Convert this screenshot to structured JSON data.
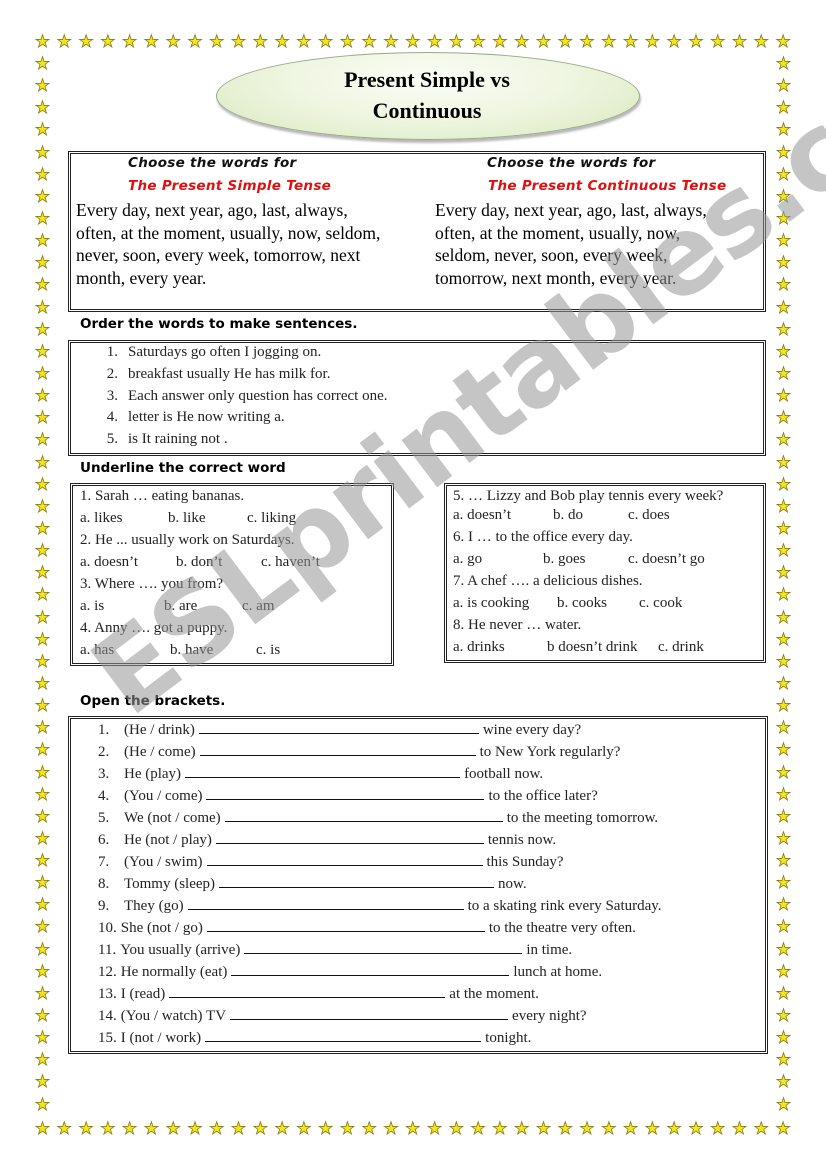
{
  "document": {
    "title_line1": "Present Simple vs",
    "title_line2": "Continuous",
    "watermark": "ESLprintables.com"
  },
  "border": {
    "icon": "star-icon",
    "glyph": "★",
    "fill_color": "#f4e61e",
    "outline_color": "#8a7d10"
  },
  "word_boxes": [
    {
      "heading": "Choose the words for",
      "tense": "The Present Simple Tense",
      "lines": [
        "Every day, next year, ago, last, always,",
        "often, at the moment, usually, now, seldom,",
        "never, soon, every week, tomorrow, next",
        "month, every year."
      ]
    },
    {
      "heading": "Choose the words for",
      "tense": "The Present Continuous Tense",
      "lines": [
        "Every day, next year, ago, last, always,",
        "often, at the moment, usually, now,",
        "seldom, never, soon, every week,",
        "tomorrow, next month, every year."
      ]
    }
  ],
  "order_section": {
    "heading": "Order the words to make sentences.",
    "items": [
      {
        "num": "1.",
        "text": "Saturdays go often I jogging on."
      },
      {
        "num": "2.",
        "text": "breakfast usually He has milk for."
      },
      {
        "num": "3.",
        "text": "Each answer only question has correct one."
      },
      {
        "num": "4.",
        "text": "letter is  He now writing a."
      },
      {
        "num": "5.",
        "text": "is It raining not ."
      }
    ]
  },
  "underline_section": {
    "heading": "Underline the correct word",
    "left_questions": [
      {
        "q": "1. Sarah … eating bananas.",
        "options": [
          "a. likes",
          "b. like",
          "c. liking"
        ]
      },
      {
        "q": "2. He ... usually work on Saturdays.",
        "options": [
          "a. doesn’t",
          "b. don’t",
          "c. haven’t"
        ]
      },
      {
        "q": "3. Where …. you from?",
        "options": [
          "a. is",
          "b. are",
          "c. am"
        ]
      },
      {
        "q": "4. Anny …. got a puppy.",
        "options": [
          "a. has",
          "b. have",
          "c. is"
        ]
      }
    ],
    "right_questions": [
      {
        "q": "5. … Lizzy and Bob play tennis every week?",
        "options": [
          "a. doesn’t",
          "b. do",
          "c. does"
        ]
      },
      {
        "q": "6. I … to the office every day.",
        "options": [
          "a. go",
          "b. goes",
          "c. doesn’t go"
        ]
      },
      {
        "q": "7. A chef …. a delicious dishes.",
        "options": [
          "a. is cooking",
          "b. cooks",
          "c. cook"
        ]
      },
      {
        "q": "8. He never … water.",
        "options": [
          "a. drinks",
          "b doesn’t drink",
          "c. drink"
        ]
      }
    ]
  },
  "brackets_section": {
    "heading": "Open the brackets.",
    "items": [
      {
        "num": "1.",
        "prompt": "(He / drink)",
        "rest": "wine every day?"
      },
      {
        "num": "2.",
        "prompt": "(He / come)",
        "rest": "to New York regularly?"
      },
      {
        "num": "3.",
        "prompt": "He (play)",
        "rest": "football now."
      },
      {
        "num": "4.",
        "prompt": "(You / come)",
        "rest": "to the office later?"
      },
      {
        "num": "5.",
        "prompt": "We (not / come)",
        "rest": "to the meeting tomorrow."
      },
      {
        "num": "6.",
        "prompt": "He (not / play)",
        "rest": "tennis now."
      },
      {
        "num": "7.",
        "prompt": "(You / swim)",
        "rest": "this Sunday?"
      },
      {
        "num": "8.",
        "prompt": "Tommy (sleep)",
        "rest": "now."
      },
      {
        "num": "9.",
        "prompt": "They (go)",
        "rest": "to a skating rink every Saturday."
      },
      {
        "num": "10.",
        "prompt": "She (not / go)",
        "rest": "to the theatre very often."
      },
      {
        "num": "11.",
        "prompt": "You usually (arrive)",
        "rest": "in time."
      },
      {
        "num": "12.",
        "prompt": "He normally (eat)",
        "rest": "lunch at home."
      },
      {
        "num": "13.",
        "prompt": "I (read)",
        "rest": "at the moment."
      },
      {
        "num": "14.",
        "prompt": "(You / watch) TV",
        "rest": "every night?"
      },
      {
        "num": "15.",
        "prompt": "I (not / work)",
        "rest": "tonight."
      }
    ]
  }
}
